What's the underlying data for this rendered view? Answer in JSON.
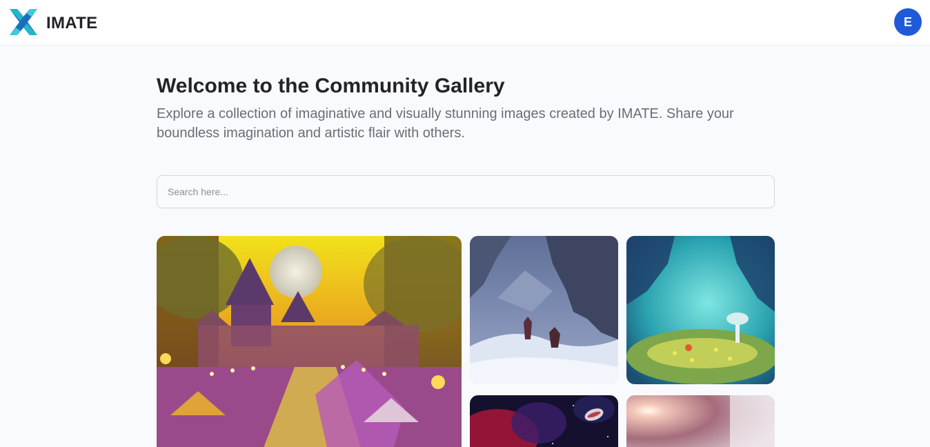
{
  "header": {
    "brand": "IMATE",
    "avatar_initial": "E",
    "logo_icon": "imate-x-logo-icon"
  },
  "main": {
    "title": "Welcome to the Community Gallery",
    "subtitle": "Explore a collection of imaginative and visually stunning images created by IMATE. Share your boundless imagination and artistic flair with others."
  },
  "search": {
    "placeholder": "Search here...",
    "value": ""
  },
  "gallery": {
    "images": [
      {
        "subject": "fantasy carnival village at night with full moon"
      },
      {
        "subject": "two figures in a snowy ice cave"
      },
      {
        "subject": "turquoise cave with glowing mushroom"
      },
      {
        "subject": "red nebula in space with planet"
      },
      {
        "subject": "bright sun glare in pink sky"
      }
    ]
  },
  "colors": {
    "background": "#f9fafe",
    "accent": "#1f5bd8",
    "logo_teal": "#24b6c9",
    "logo_blue": "#1a6fbd"
  }
}
